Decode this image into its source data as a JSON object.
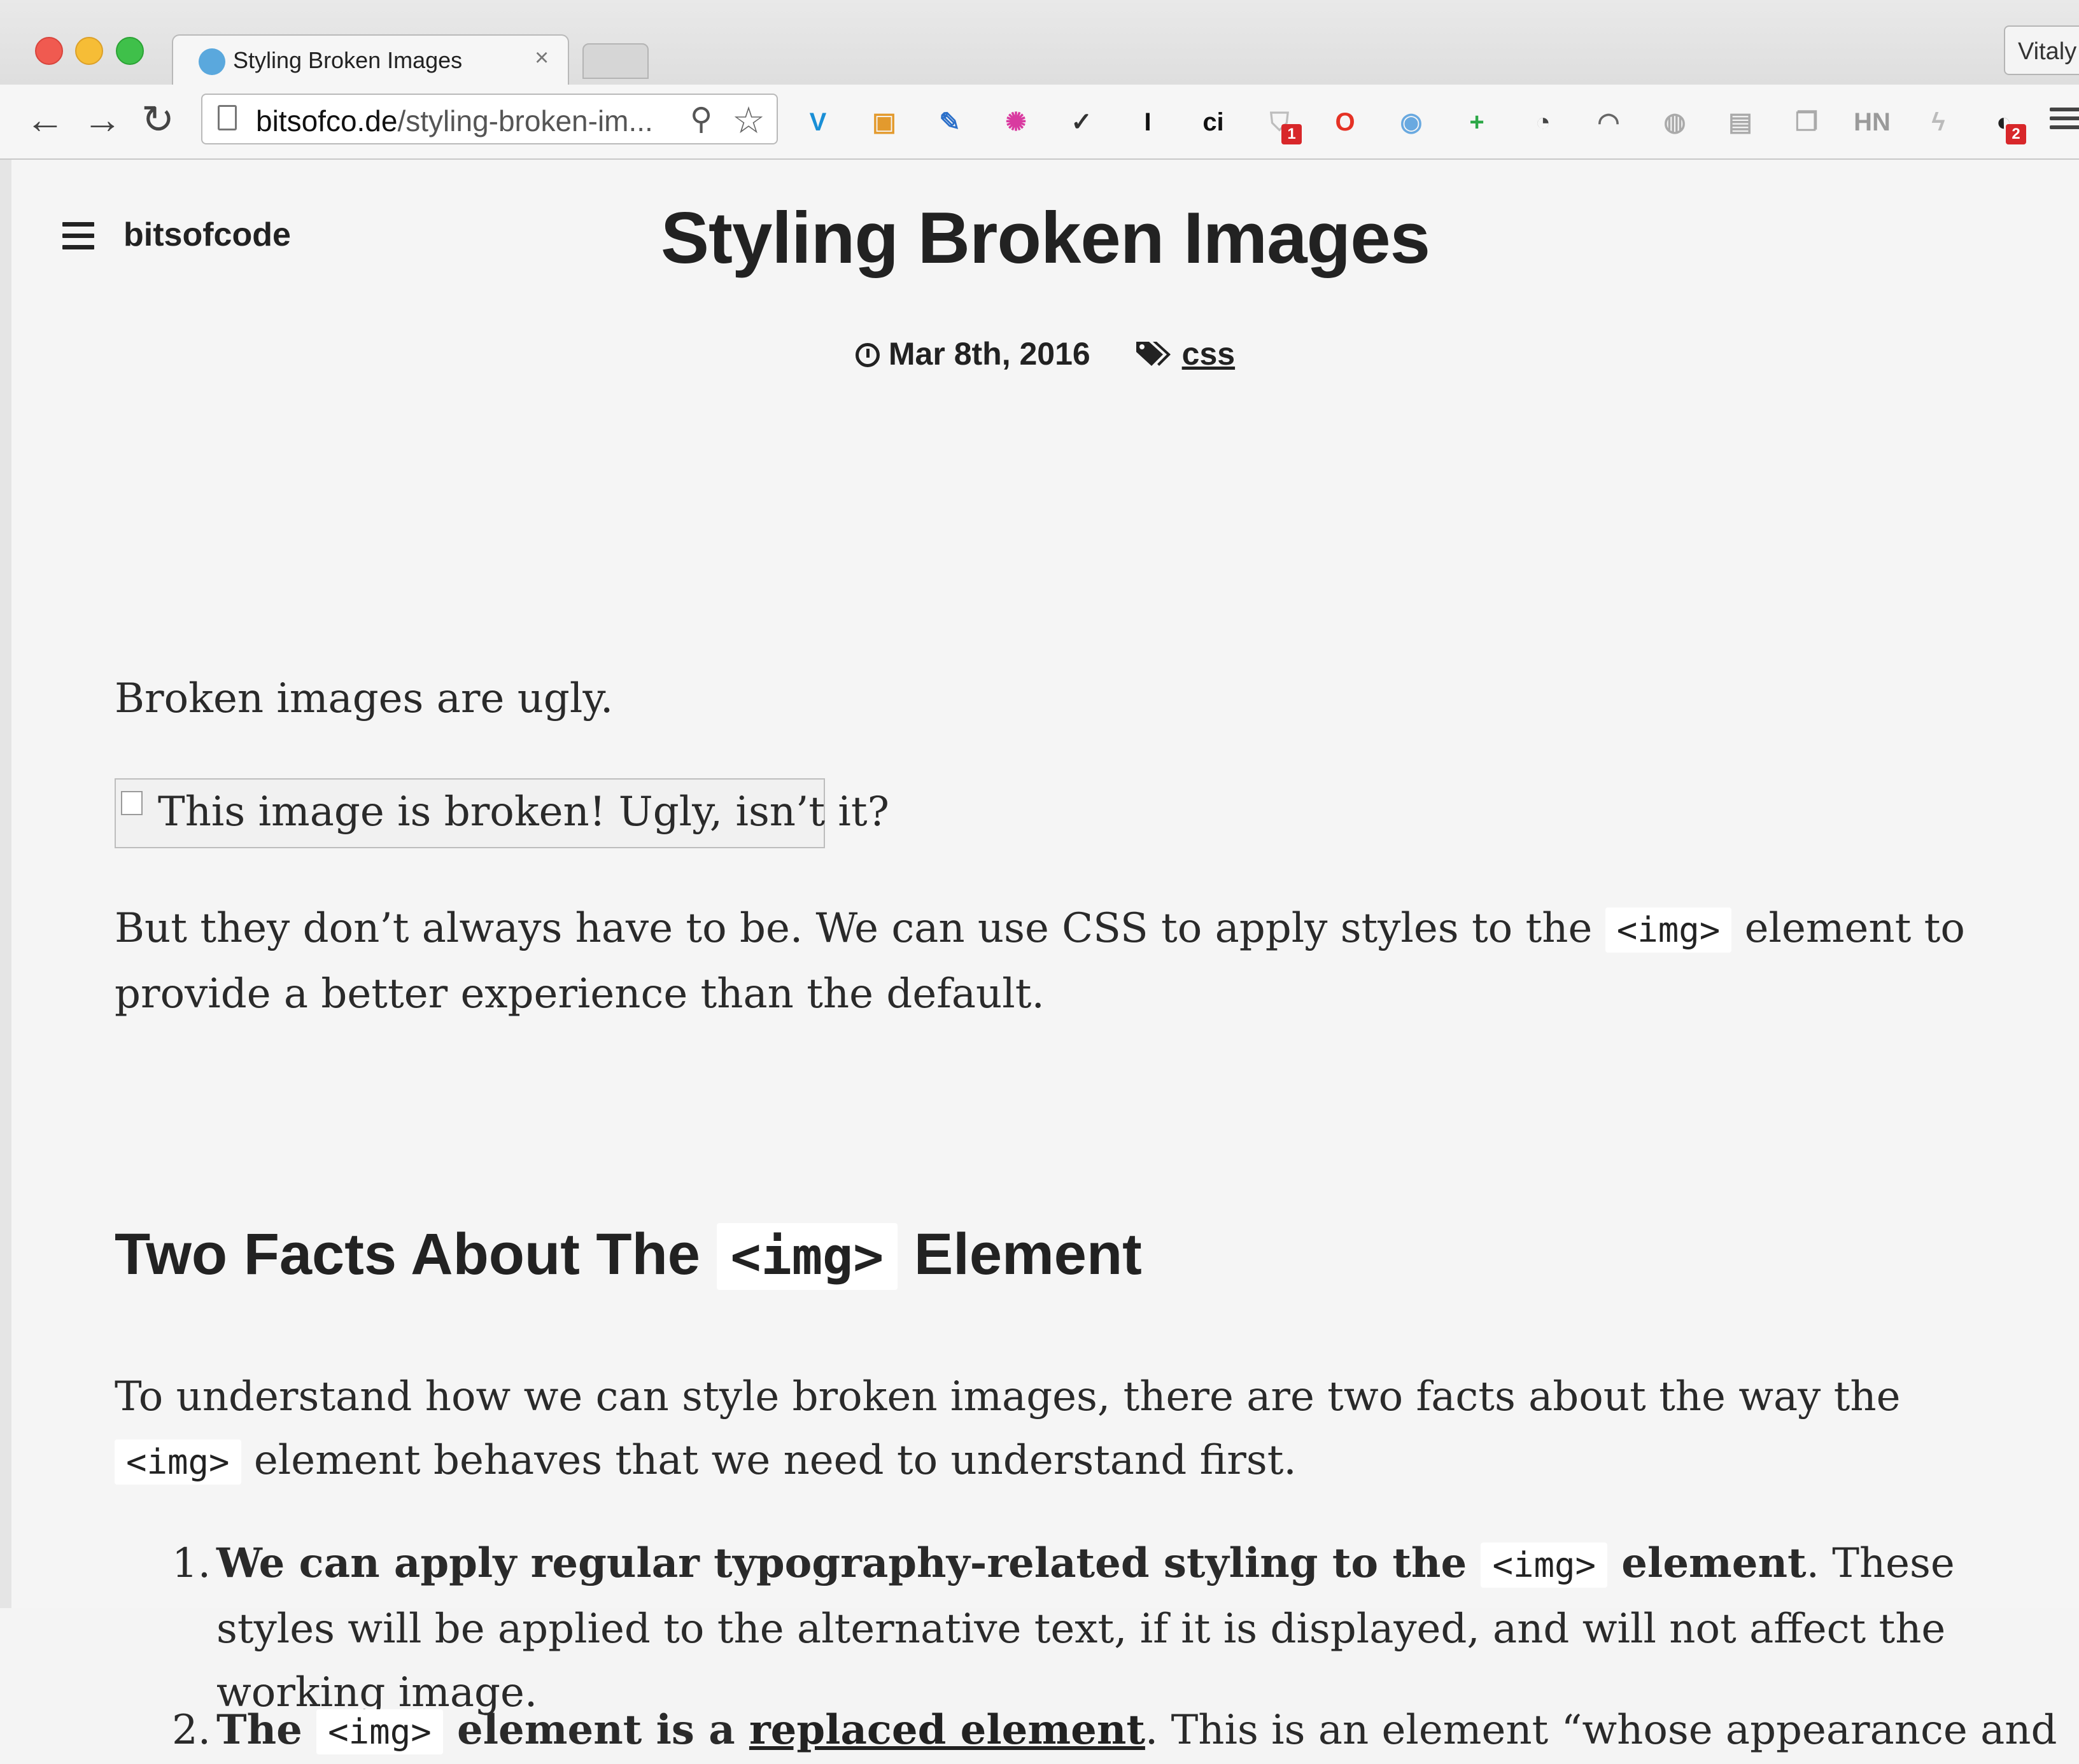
{
  "browser": {
    "tab_title": "Styling Broken Images",
    "tab_close": "×",
    "profile_name": "Vitaly",
    "url_domain": "bitsofco.de",
    "url_path": "/styling-broken-im...",
    "nav": {
      "back": "←",
      "forward": "→",
      "reload": "↻"
    },
    "extensions": [
      {
        "name": "vimeo-v-icon",
        "glyph": "V",
        "color": "#1a8fd6"
      },
      {
        "name": "package-icon",
        "glyph": "▣",
        "color": "#e39a2d"
      },
      {
        "name": "pen-tool-icon",
        "glyph": "✎",
        "color": "#2b6fc9"
      },
      {
        "name": "color-wheel-icon",
        "glyph": "✺",
        "color": "#d93aa0"
      },
      {
        "name": "checkmark-app-icon",
        "glyph": "✓",
        "color": "#333333"
      },
      {
        "name": "instapaper-icon",
        "glyph": "I",
        "color": "#111111"
      },
      {
        "name": "ci-icon",
        "glyph": "ci",
        "color": "#111111"
      },
      {
        "name": "shield-icon",
        "glyph": "⛉",
        "color": "#bdbdbd",
        "badge": "1"
      },
      {
        "name": "opera-icon",
        "glyph": "O",
        "color": "#e53225"
      },
      {
        "name": "camera-icon",
        "glyph": "◉",
        "color": "#69a9e0"
      },
      {
        "name": "plus-extension-icon",
        "glyph": "+",
        "color": "#2da848"
      },
      {
        "name": "timer-icon",
        "glyph": "◔",
        "color": "#444444"
      },
      {
        "name": "speedometer-icon",
        "glyph": "◠",
        "color": "#666666"
      },
      {
        "name": "globe-icon",
        "glyph": "◍",
        "color": "#aaaaaa"
      },
      {
        "name": "page-action-icon",
        "glyph": "▤",
        "color": "#aaaaaa"
      },
      {
        "name": "copy-icon",
        "glyph": "❐",
        "color": "#aaaaaa"
      },
      {
        "name": "hn-icon",
        "glyph": "HN",
        "color": "#9a9a9a"
      },
      {
        "name": "lightning-icon",
        "glyph": "ϟ",
        "color": "#bbbbbb"
      },
      {
        "name": "reader-glasses-icon",
        "glyph": "◐",
        "color": "#222222",
        "badge": "2"
      }
    ]
  },
  "site": {
    "name": "bitsofcode"
  },
  "post": {
    "title": "Styling Broken Images",
    "date": "Mar 8th, 2016",
    "tag": "css",
    "p1": "Broken images are ugly.",
    "broken_alt": "This image is broken! Ugly, isn’t it?",
    "p2_a": "But they don’t always have to be. We can use CSS to apply styles to the ",
    "p2_code": "<img>",
    "p2_b": " element to provide a better experience than the default.",
    "h2_a": "Two Facts About The ",
    "h2_code": "<img>",
    "h2_b": " Element",
    "p3_a": "To understand how we can style broken images, there are two facts about the way the ",
    "p3_code": "<img>",
    "p3_b": " element behaves that we need to understand first.",
    "li1_num": "1.",
    "li1_bold_a": "We can apply regular typography-related styling to the ",
    "li1_code": "<img>",
    "li1_bold_b": " element",
    "li1_rest": ". These styles will be applied to the alternative text, if it is displayed, and will not affect the working image.",
    "li2_num": "2.",
    "li2_bold_a": "The ",
    "li2_code": "<img>",
    "li2_bold_b": " element is a ",
    "li2_link": "replaced element",
    "li2_rest": ". This is an element “whose appearance and"
  }
}
